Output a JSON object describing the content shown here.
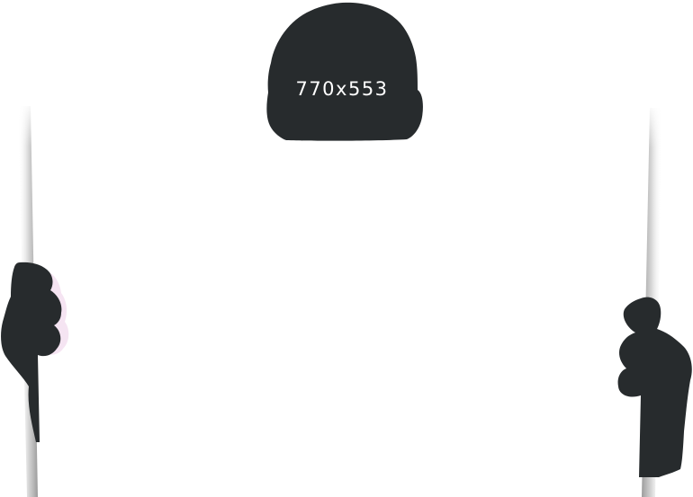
{
  "placeholder": {
    "dimensions_text": "770x553"
  },
  "colors": {
    "background": "#ffffff",
    "silhouette": "#272b2d",
    "paper_edge_shadow": "#c9c9c9",
    "hand_glow": "#f3dff0",
    "label_text": "#ffffff"
  },
  "icons": {
    "head": "head-silhouette-icon",
    "left_hand": "left-hand-icon",
    "right_hand": "right-hand-icon"
  }
}
